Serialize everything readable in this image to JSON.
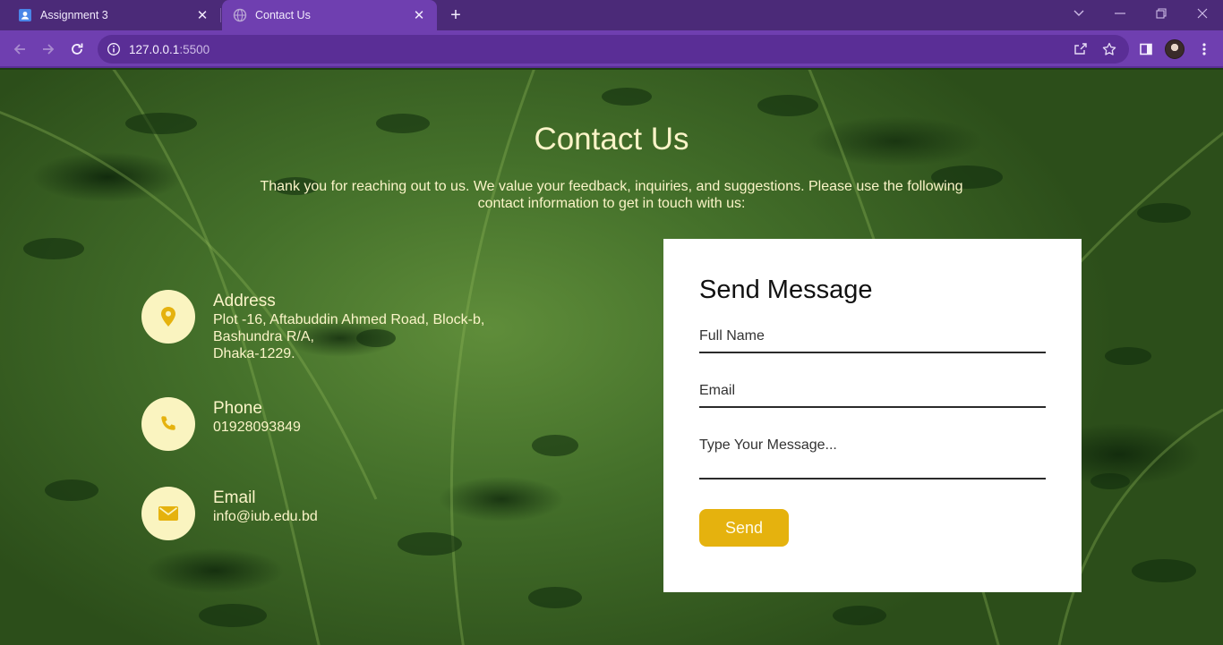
{
  "browser": {
    "tabs": [
      {
        "title": "Assignment 3",
        "active": false,
        "favicon": "contacts-icon"
      },
      {
        "title": "Contact Us",
        "active": true,
        "favicon": "globe-icon"
      }
    ],
    "url_host": "127.0.0.1",
    "url_port": ":5500"
  },
  "page": {
    "title": "Contact Us",
    "intro": "Thank you for reaching out to us. We value your feedback, inquiries, and suggestions. Please use the following contact information to get in touch with us:",
    "contacts": [
      {
        "icon": "map-pin-icon",
        "label": "Address",
        "value": "Plot -16, Aftabuddin Ahmed Road, Block-b,\nBashundra R/A,\nDhaka-1229."
      },
      {
        "icon": "phone-icon",
        "label": "Phone",
        "value": "01928093849"
      },
      {
        "icon": "envelope-icon",
        "label": "Email",
        "value": "info@iub.edu.bd"
      }
    ],
    "form": {
      "title": "Send Message",
      "name_placeholder": "Full Name",
      "email_placeholder": "Email",
      "message_placeholder": "Type Your Message...",
      "send_label": "Send"
    }
  },
  "colors": {
    "chrome_dark": "#4b2a78",
    "chrome": "#6f3fb0",
    "accent": "#e5b20e",
    "text_light": "#fbf4c8",
    "icon_circle": "#faf4c0"
  }
}
